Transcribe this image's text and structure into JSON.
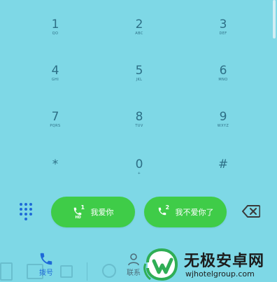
{
  "keypad": {
    "keys": [
      {
        "digit": "1",
        "letters": "QO"
      },
      {
        "digit": "2",
        "letters": "ABC"
      },
      {
        "digit": "3",
        "letters": "DEF"
      },
      {
        "digit": "4",
        "letters": "GHI"
      },
      {
        "digit": "5",
        "letters": "JKL"
      },
      {
        "digit": "6",
        "letters": "MNO"
      },
      {
        "digit": "7",
        "letters": "PQRS"
      },
      {
        "digit": "8",
        "letters": "TUV"
      },
      {
        "digit": "9",
        "letters": "WXYZ"
      },
      {
        "digit": "*",
        "letters": ""
      },
      {
        "digit": "0",
        "letters": "+"
      },
      {
        "digit": "#",
        "letters": ""
      }
    ]
  },
  "dial": {
    "call1_label": "我爱你",
    "call1_sim": "1",
    "call1_badge": "HD",
    "call2_label": "我不爱你了",
    "call2_sim": "2"
  },
  "tabs": {
    "dial_label": "拨号",
    "contacts_label": "联系"
  },
  "watermark": {
    "brand": "无极安卓网",
    "url": "wjhotelgroup.com"
  },
  "colors": {
    "background": "#7ed8e6",
    "call_button": "#3fcc48",
    "accent_blue": "#1e69d8",
    "key_text": "#2d6f86"
  }
}
